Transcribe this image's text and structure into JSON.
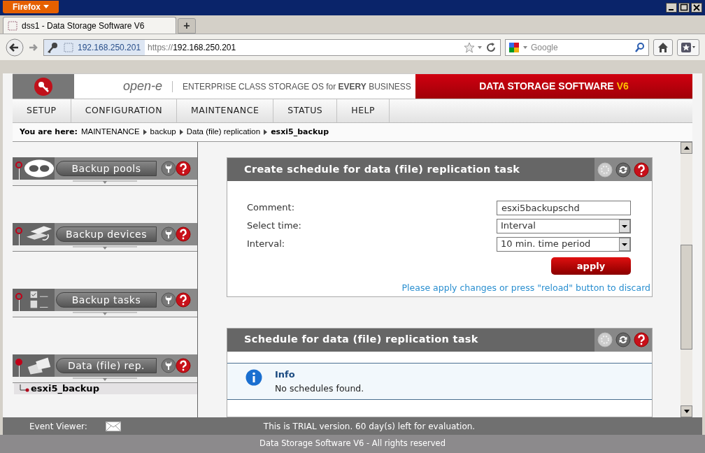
{
  "browser": {
    "app_button": "Firefox",
    "tab_title": "dss1 - Data Storage Software V6",
    "new_tab": "+",
    "identity": "192.168.250.201",
    "url_scheme": "https://",
    "url_host": "192.168.250.201",
    "search_placeholder": "Google"
  },
  "header": {
    "brand": "open-e",
    "tagline": "ENTERPRISE CLASS STORAGE OS for **EVERY** BUSINESS",
    "product": "DATA STORAGE SOFTWARE",
    "version": "V6"
  },
  "menu": [
    {
      "label": "SETUP"
    },
    {
      "label": "CONFIGURATION"
    },
    {
      "label": "MAINTENANCE"
    },
    {
      "label": "STATUS"
    },
    {
      "label": "HELP"
    }
  ],
  "breadcrumb": {
    "prefix": "You are here:",
    "items": [
      "MAINTENANCE",
      "backup",
      "Data (file) replication"
    ],
    "current": "esxi5_backup"
  },
  "sidebar": {
    "sections": [
      {
        "kind": "pools",
        "title": "Backup pools",
        "active": false
      },
      {
        "kind": "devices",
        "title": "Backup devices",
        "active": false
      },
      {
        "kind": "tasks",
        "title": "Backup tasks",
        "active": false
      },
      {
        "kind": "replication",
        "title": "Data (file) rep.",
        "active": true,
        "children": [
          {
            "label": "esxi5_backup"
          }
        ]
      }
    ]
  },
  "create_panel": {
    "title": "Create schedule for data (file) replication task",
    "fields": [
      {
        "kind": "text",
        "label": "Comment:",
        "value": "esxi5backupschd"
      },
      {
        "kind": "select",
        "label": "Select time:",
        "value": "Interval"
      },
      {
        "kind": "select",
        "label": "Interval:",
        "value": "10 min. time period"
      }
    ],
    "apply": "apply",
    "hint": "Please apply changes or press \"reload\" button to discard"
  },
  "schedule_panel": {
    "title": "Schedule for data (file) replication task",
    "info_title": "Info",
    "info_message": "No schedules found."
  },
  "footer": {
    "event_viewer": "Event Viewer:",
    "trial": "This is TRIAL version. 60 day(s) left for evaluation.",
    "copyright": "Data Storage Software V6 - All rights reserved"
  }
}
